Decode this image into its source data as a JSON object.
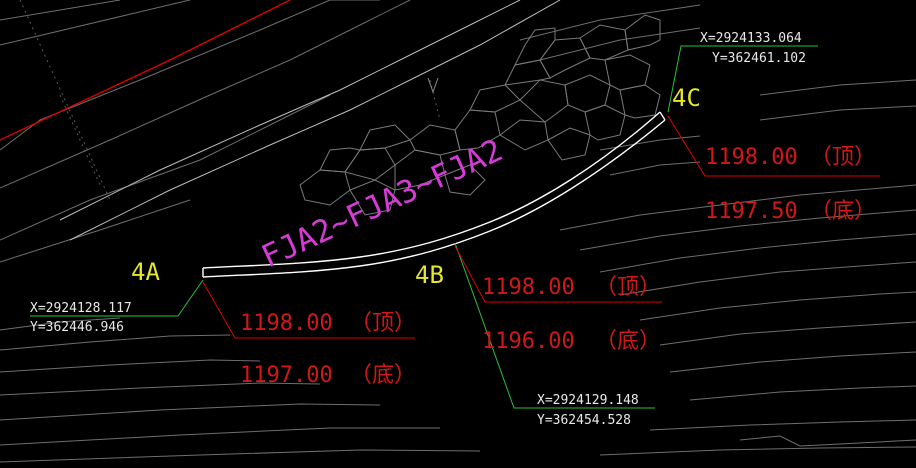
{
  "colors": {
    "background": "#000000",
    "contour": "#8a8a8a",
    "road_edge": "#bdbdbd",
    "boundary": "#e00000",
    "leader": "#27c03a",
    "elevation_text": "#d01818",
    "coord_text": "#e8e8e8",
    "point_label": "#e6e62a",
    "route_label": "#d63bd6",
    "pipe": "#ffffff"
  },
  "route_label": "FJA2~FJA3~FJA2",
  "points": [
    {
      "id": "4A",
      "label": "4A",
      "x_coord": "X=2924128.117",
      "y_coord": "Y=362446.946",
      "top_elev": "1198.00",
      "top_tag": "（顶）",
      "bottom_elev": "1197.00",
      "bottom_tag": "（底）"
    },
    {
      "id": "4B",
      "label": "4B",
      "x_coord": "X=2924129.148",
      "y_coord": "Y=362454.528",
      "top_elev": "1198.00",
      "top_tag": "（顶）",
      "bottom_elev": "1196.00",
      "bottom_tag": "（底）"
    },
    {
      "id": "4C",
      "label": "4C",
      "x_coord": "X=2924133.064",
      "y_coord": "Y=362461.102",
      "top_elev": "1198.00",
      "top_tag": "（顶）",
      "bottom_elev": "1197.50",
      "bottom_tag": "（底）"
    }
  ]
}
